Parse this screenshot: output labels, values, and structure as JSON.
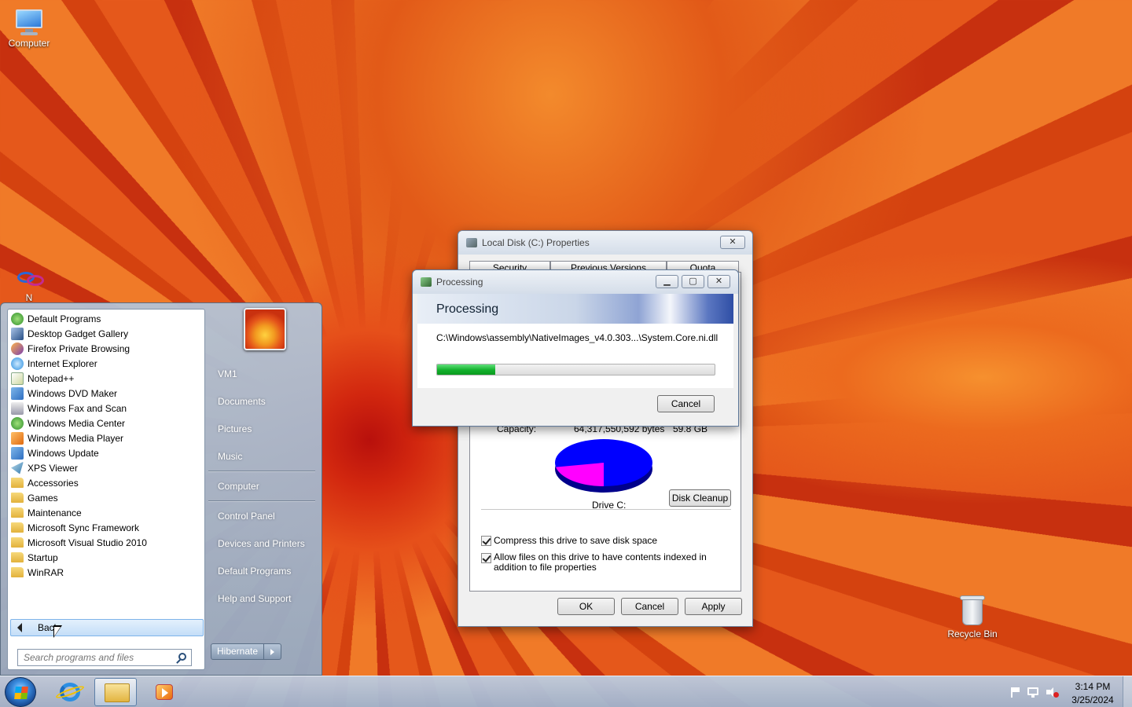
{
  "desktop": {
    "icons": [
      {
        "label": "Computer",
        "icon": "computer-icon"
      },
      {
        "label": "Recycle Bin",
        "icon": "recycle-bin-icon"
      }
    ],
    "partial_icon": {
      "label": "N",
      "icon": "network-icon"
    }
  },
  "start_menu": {
    "programs": [
      {
        "label": "Default Programs",
        "icon": "default-programs-icon"
      },
      {
        "label": "Desktop Gadget Gallery",
        "icon": "gadget-gallery-icon"
      },
      {
        "label": "Firefox Private Browsing",
        "icon": "firefox-icon"
      },
      {
        "label": "Internet Explorer",
        "icon": "internet-explorer-icon"
      },
      {
        "label": "Notepad++",
        "icon": "notepad-icon"
      },
      {
        "label": "Windows DVD Maker",
        "icon": "dvd-maker-icon"
      },
      {
        "label": "Windows Fax and Scan",
        "icon": "fax-icon"
      },
      {
        "label": "Windows Media Center",
        "icon": "media-center-icon"
      },
      {
        "label": "Windows Media Player",
        "icon": "media-player-icon"
      },
      {
        "label": "Windows Update",
        "icon": "windows-update-icon"
      },
      {
        "label": "XPS Viewer",
        "icon": "xps-viewer-icon"
      },
      {
        "label": "Accessories",
        "icon": "folder-icon"
      },
      {
        "label": "Games",
        "icon": "folder-icon"
      },
      {
        "label": "Maintenance",
        "icon": "folder-icon"
      },
      {
        "label": "Microsoft Sync Framework",
        "icon": "folder-icon"
      },
      {
        "label": "Microsoft Visual Studio 2010",
        "icon": "folder-icon"
      },
      {
        "label": "Startup",
        "icon": "folder-icon"
      },
      {
        "label": "WinRAR",
        "icon": "folder-icon"
      }
    ],
    "back_label": "Back",
    "search_placeholder": "Search programs and files",
    "places": [
      "VM1",
      "Documents",
      "Pictures",
      "Music",
      "Computer",
      "Control Panel",
      "Devices and Printers",
      "Default Programs",
      "Help and Support"
    ],
    "hibernate_label": "Hibernate"
  },
  "properties_dialog": {
    "title": "Local Disk (C:) Properties",
    "tabs": [
      "Security",
      "Previous Versions",
      "Quota"
    ],
    "capacity_label": "Capacity:",
    "capacity_bytes": "64,317,550,592 bytes",
    "capacity_gb": "59.8 GB",
    "drive_label": "Drive C:",
    "disk_cleanup_label": "Disk Cleanup",
    "compress_label": "Compress this drive to save disk space",
    "index_label": "Allow files on this drive to have contents indexed in addition to file properties",
    "ok_label": "OK",
    "cancel_label": "Cancel",
    "apply_label": "Apply",
    "used_fraction": 0.22,
    "used_color": "#ff00ff",
    "free_color": "#0000ff"
  },
  "processing_dialog": {
    "title": "Processing",
    "heading": "Processing",
    "file_path": "C:\\Windows\\assembly\\NativeImages_v4.0.303...\\System.Core.ni.dll",
    "progress_percent": 21,
    "cancel_label": "Cancel"
  },
  "taskbar": {
    "time": "3:14 PM",
    "date": "3/25/2024",
    "pinned": [
      "internet-explorer-icon",
      "windows-explorer-icon",
      "media-player-icon"
    ],
    "tray_icons": [
      "action-center-flag-icon",
      "network-icon",
      "volume-muted-icon"
    ]
  }
}
